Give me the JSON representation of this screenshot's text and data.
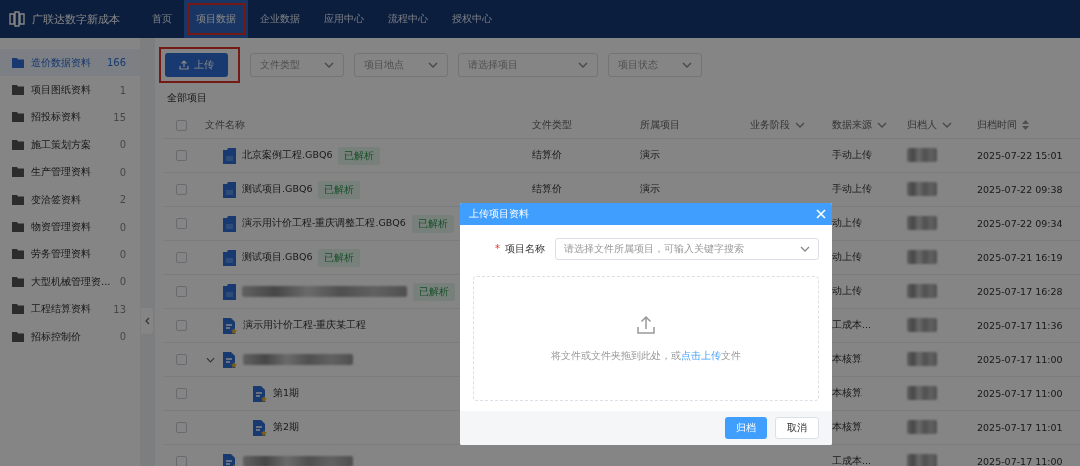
{
  "brand": "广联达数字新成本",
  "nav": [
    {
      "label": "首页",
      "selected": false
    },
    {
      "label": "项目数据",
      "selected": true,
      "highlighted": true
    },
    {
      "label": "企业数据",
      "selected": false
    },
    {
      "label": "应用中心",
      "selected": false
    },
    {
      "label": "流程中心",
      "selected": false
    },
    {
      "label": "授权中心",
      "selected": false
    }
  ],
  "sidebar": [
    {
      "label": "造价数据资料",
      "count": "166",
      "selected": true
    },
    {
      "label": "项目图纸资料",
      "count": "1",
      "selected": false
    },
    {
      "label": "招投标资料",
      "count": "15",
      "selected": false
    },
    {
      "label": "施工策划方案",
      "count": "0",
      "selected": false
    },
    {
      "label": "生产管理资料",
      "count": "0",
      "selected": false
    },
    {
      "label": "变洽签资料",
      "count": "2",
      "selected": false
    },
    {
      "label": "物资管理资料",
      "count": "0",
      "selected": false
    },
    {
      "label": "劳务管理资料",
      "count": "0",
      "selected": false
    },
    {
      "label": "大型机械管理资...",
      "count": "0",
      "selected": false
    },
    {
      "label": "工程结算资料",
      "count": "13",
      "selected": false
    },
    {
      "label": "招标控制价",
      "count": "0",
      "selected": false
    }
  ],
  "toolbar": {
    "upload_button": "上传",
    "upload_highlighted": true,
    "filters": [
      "文件类型",
      "项目地点",
      "请选择项目",
      "项目状态"
    ]
  },
  "section_title": "全部项目",
  "columns": [
    {
      "label": "文件名称"
    },
    {
      "label": "文件类型"
    },
    {
      "label": "所属项目"
    },
    {
      "label": "业务阶段",
      "kind": "filter"
    },
    {
      "label": "数据来源",
      "kind": "filter"
    },
    {
      "label": "归档人",
      "kind": "filter"
    },
    {
      "label": "归档时间",
      "kind": "sort"
    }
  ],
  "header_checked": false,
  "rows": [
    {
      "kind": "gbq",
      "name": "北京案例工程.GBQ6",
      "tag": "已解析",
      "type": "结算价",
      "project": "演示",
      "source": "手动上传",
      "time": "2025-07-22 15:01",
      "checked": false
    },
    {
      "kind": "gbq",
      "name": "测试项目.GBQ6",
      "tag": "已解析",
      "type": "结算价",
      "project": "演示",
      "source": "手动上传",
      "time": "2025-07-22 09:38",
      "checked": false
    },
    {
      "kind": "gbq",
      "name": "演示用计价工程-重庆调整工程.GBQ6",
      "tag": "已解析",
      "source": "动上传",
      "time": "2025-07-22 09:34",
      "checked": false
    },
    {
      "kind": "gbq",
      "name": "测试项目.GBQ6",
      "tag": "已解析",
      "source": "动上传",
      "time": "2025-07-21 16:19",
      "checked": false
    },
    {
      "kind": "gbq",
      "name_blurred": true,
      "tag": "已解析",
      "source": "动上传",
      "time": "2025-07-17 16:28",
      "checked": false
    },
    {
      "kind": "project",
      "name": "演示用计价工程-重庆某工程",
      "source": "工成本...",
      "time": "2025-07-17 11:36",
      "checked": false
    },
    {
      "kind": "project",
      "name_blurred": true,
      "expanded": true,
      "source": "本核算",
      "time": "2025-07-17 11:00",
      "checked": false,
      "children": [
        {
          "kind": "project",
          "name": "第1期",
          "source": "本核算",
          "time": "2025-07-17 11:00",
          "checked": false
        },
        {
          "kind": "project",
          "name": "第2期",
          "source": "本核算",
          "time": "2025-07-17 11:01",
          "checked": false
        }
      ]
    },
    {
      "kind": "project",
      "name_blurred": true,
      "source": "工成本...",
      "time": "2025-07-17 11:00",
      "checked": false
    }
  ],
  "modal": {
    "title": "上传项目资料",
    "field_label": "项目名称",
    "required_mark": "*",
    "field_placeholder": "请选择文件所属项目，可输入关键字搜索",
    "drop_hint_before": "将文件或文件夹拖到此处，或",
    "drop_link": "点击上传",
    "drop_hint_after": "文件",
    "primary_button": "归档",
    "cancel_button": "取消"
  }
}
